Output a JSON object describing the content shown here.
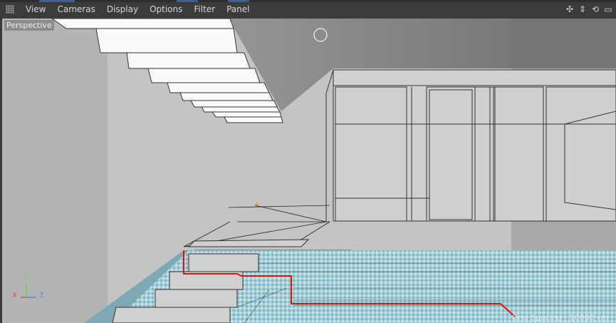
{
  "menu": {
    "items": [
      "View",
      "Cameras",
      "Display",
      "Options",
      "Filter",
      "Panel"
    ]
  },
  "nav_icons": [
    {
      "name": "move-view-icon",
      "glyph": "✣"
    },
    {
      "name": "zoom-view-icon",
      "glyph": "⇕"
    },
    {
      "name": "rotate-view-icon",
      "glyph": "⟲"
    },
    {
      "name": "toggle-layout-icon",
      "glyph": "▭"
    }
  ],
  "viewport": {
    "camera_label": "Perspective",
    "grid_spacing": "Grid Spacing : 10000 cm",
    "axes": {
      "y": "Y",
      "x": "X",
      "z": "Z"
    }
  },
  "colors": {
    "axis_y": "#5fd35f",
    "axis_x": "#e05050",
    "axis_z": "#5a86e6",
    "selection_spline": "#e01010",
    "pool_tile": "#9fc7d2"
  }
}
